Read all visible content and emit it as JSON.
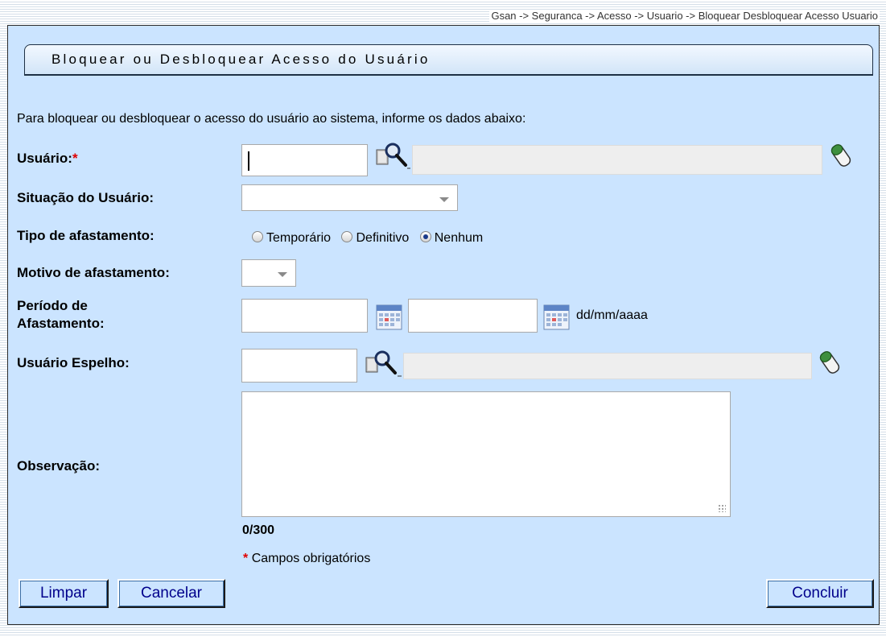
{
  "breadcrumb": "Gsan -> Seguranca -> Acesso -> Usuario -> Bloquear Desbloquear Acesso Usuario",
  "title": "Bloquear ou Desbloquear Acesso do Usuário",
  "instruction": "Para bloquear ou desbloquear o acesso do usuário ao sistema, informe os dados abaixo:",
  "fields": {
    "usuario_label": "Usuário:",
    "required_mark": "*",
    "situacao_label": "Situação do Usuário:",
    "tipo_label": "Tipo de afastamento:",
    "motivo_label": "Motivo de afastamento:",
    "periodo_label_line1": "Período de",
    "periodo_label_line2": "Afastamento:",
    "date_hint": "dd/mm/aaaa",
    "espelho_label": "Usuário Espelho:",
    "observacao_label": "Observação:",
    "counter": "0/300",
    "required_note": "Campos obrigatórios"
  },
  "values": {
    "usuario": "",
    "usuario_nome": "",
    "situacao": "",
    "motivo": "",
    "periodo_inicio": "",
    "periodo_fim": "",
    "espelho": "",
    "espelho_nome": "",
    "observacao": ""
  },
  "radios": {
    "temporario": "Temporário",
    "definitivo": "Definitivo",
    "nenhum": "Nenhum",
    "selected": "nenhum"
  },
  "buttons": {
    "limpar": "Limpar",
    "cancelar": "Cancelar",
    "concluir": "Concluir"
  },
  "icons": {
    "search": "search-icon",
    "eraser": "eraser-icon",
    "calendar": "calendar-icon"
  },
  "colors": {
    "panel_bg": "#cbe4ff",
    "button_text": "#00008b",
    "required": "#e00000"
  }
}
